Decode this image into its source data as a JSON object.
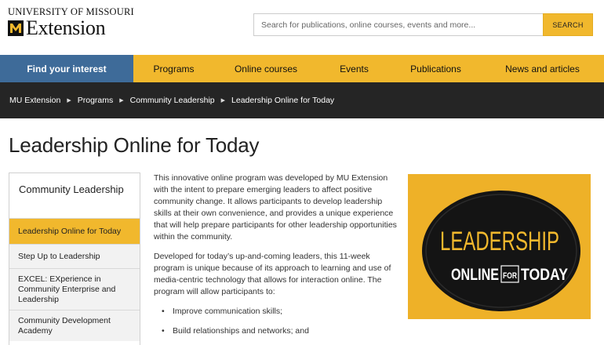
{
  "header": {
    "logo_top": "UNIVERSITY OF MISSOURI",
    "logo_bottom": "Extension",
    "search": {
      "placeholder": "Search for publications, online courses, events and more...",
      "button_label": "SEARCH"
    }
  },
  "nav": {
    "items": [
      {
        "label": "Find your interest",
        "active": true
      },
      {
        "label": "Programs"
      },
      {
        "label": "Online courses"
      },
      {
        "label": "Events"
      },
      {
        "label": "Publications"
      },
      {
        "label": "News and articles"
      }
    ]
  },
  "breadcrumb": {
    "items": [
      "MU Extension",
      "Programs",
      "Community Leadership",
      "Leadership Online for Today"
    ]
  },
  "page": {
    "title": "Leadership Online for Today"
  },
  "sidebar": {
    "heading": "Community Leadership",
    "items": [
      {
        "label": "Leadership Online for Today",
        "active": true
      },
      {
        "label": "Step Up to Leadership"
      },
      {
        "label": "EXCEL: EXperience in Community Enterprise and Leadership"
      },
      {
        "label": "Community Development Academy"
      }
    ]
  },
  "content": {
    "paragraphs": [
      "This innovative online program was developed by MU Extension with the intent to prepare emerging leaders to affect positive community change. It allows participants to develop leadership skills at their own convenience, and provides a unique experience that will help prepare participants for other leadership opportunities within the community.",
      "Developed for today’s up-and-coming leaders, this 11-week program is unique because of its approach to learning and use of media-centric technology that allows for interaction online. The program will allow participants to:"
    ],
    "bullets": [
      "Improve communication skills;",
      "Build relationships and networks; and"
    ]
  },
  "promo": {
    "line1": "LEADERSHIP",
    "line2a": "ONLINE",
    "line2b": "FOR",
    "line2c": "TODAY",
    "colors": {
      "background": "#f0b52b",
      "circle": "#141414",
      "text_yellow": "#f1b82d",
      "text_white": "#ffffff"
    }
  },
  "colors": {
    "gold": "#f1b82d",
    "nav_active": "#3e6b99",
    "breadcrumb_bg": "#252525"
  }
}
